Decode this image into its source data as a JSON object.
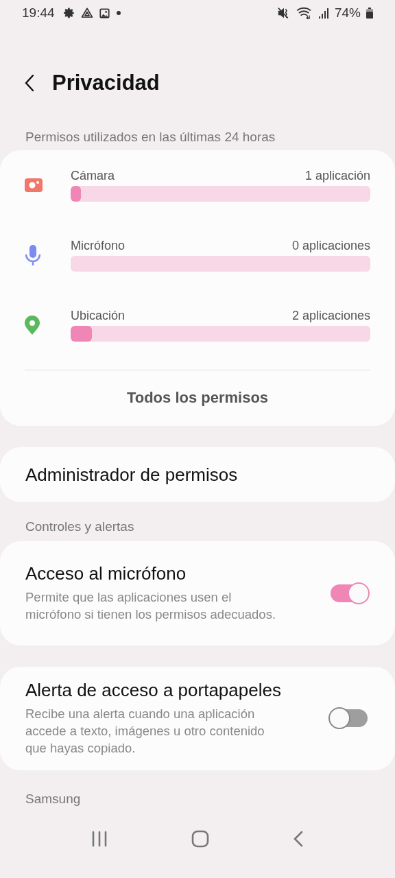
{
  "status_bar": {
    "time": "19:44",
    "battery": "74%"
  },
  "header": {
    "title": "Privacidad"
  },
  "usage": {
    "heading": "Permisos utilizados en las últimas 24 horas",
    "items": [
      {
        "kind": "camera",
        "name": "Cámara",
        "count": "1 aplicación",
        "level": 0.035
      },
      {
        "kind": "microphone",
        "name": "Micrófono",
        "count": "0 aplicaciones"
      },
      {
        "kind": "location",
        "name": "Ubicación",
        "count": "2 aplicaciones",
        "level": 0.07
      }
    ],
    "all_button": "Todos los permisos"
  },
  "manager": {
    "label": "Administrador de permisos"
  },
  "controls": {
    "heading": "Controles y alertas",
    "items": [
      {
        "title": "Acceso al micrófono",
        "description": "Permite que las aplicaciones usen el micrófono si tienen los permisos adecuados.",
        "on": true
      },
      {
        "title": "Alerta de acceso a portapapeles",
        "description": "Recibe una alerta cuando una aplicación accede a texto, imágenes u otro contenido que hayas copiado.",
        "on": false
      }
    ]
  },
  "next_heading": "Samsung"
}
